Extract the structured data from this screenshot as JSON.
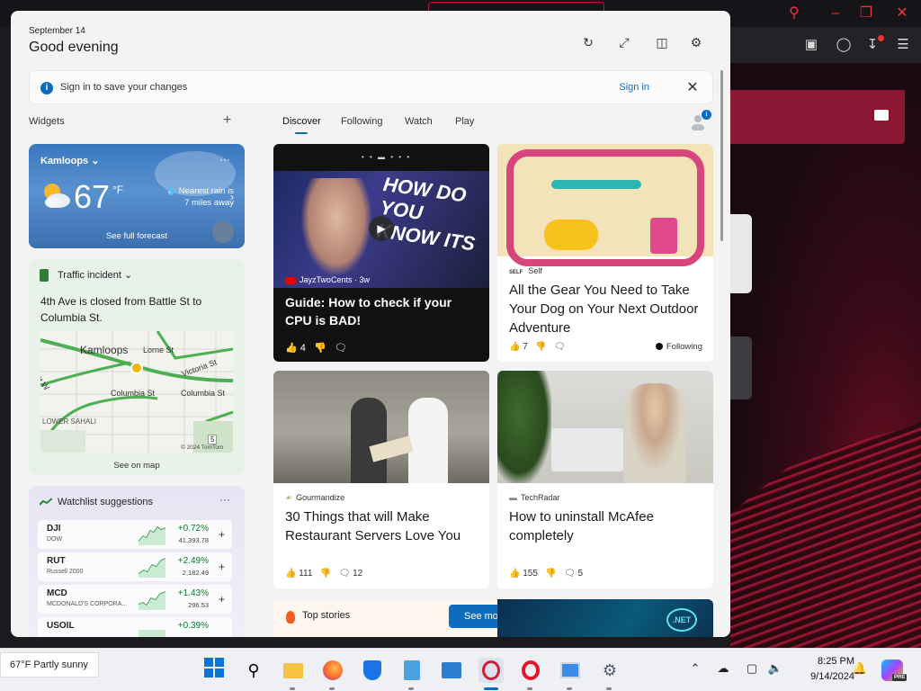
{
  "header": {
    "date": "September 14",
    "greeting": "Good evening"
  },
  "signin": {
    "message": "Sign in to save your changes",
    "link": "Sign in",
    "close": "✕"
  },
  "widgets": {
    "label": "Widgets",
    "add": "+"
  },
  "weather": {
    "city": "Kamloops",
    "temp": "67",
    "unit": "°F",
    "rain": "Nearest rain is 7 miles away",
    "forecast_link": "See full forecast",
    "more": "···"
  },
  "traffic": {
    "title": "Traffic incident",
    "description": "4th Ave is closed from Battle St to Columbia St.",
    "see_on_map": "See on map",
    "map_labels": {
      "city": "Kamloops",
      "lorne": "Lorne St",
      "victoria": "Victoria St",
      "columbia_left": "Columbia St",
      "columbia_right": "Columbia St",
      "street_w": "St W",
      "sahali": "LOWER SAHALI",
      "route": "5",
      "copyright": "© 2024 TomTom"
    }
  },
  "watchlist": {
    "title": "Watchlist suggestions",
    "more": "···",
    "items": [
      {
        "symbol": "DJI",
        "name": "DOW",
        "change": "+0.72%",
        "price": "41,393.78"
      },
      {
        "symbol": "RUT",
        "name": "Russell 2000",
        "change": "+2.49%",
        "price": "2,182.49"
      },
      {
        "symbol": "MCD",
        "name": "MCDONALD'S CORPORA...",
        "change": "+1.43%",
        "price": "296.53"
      },
      {
        "symbol": "USOIL",
        "name": "",
        "change": "+0.39%",
        "price": ""
      }
    ]
  },
  "tabs": [
    "Discover",
    "Following",
    "Watch",
    "Play"
  ],
  "profile_badge": "i",
  "cards": {
    "video": {
      "source": "JayzTwoCents · 3w",
      "title": "Guide: How to check if your CPU is BAD!",
      "likes": "4",
      "thumb_text": "HOW DO YOU KNOW ITS"
    },
    "dog": {
      "source_logo": "SELF",
      "source": "Self",
      "title": "All the Gear You Need to Take Your Dog on Your Next Outdoor Adventure",
      "likes": "7",
      "following": "Following"
    },
    "servers": {
      "source": "Gourmandize",
      "title": "30 Things that will Make Restaurant Servers Love You",
      "likes": "111",
      "comments": "12"
    },
    "mcafee": {
      "source": "TechRadar",
      "title": "How to uninstall McAfee completely",
      "likes": "155",
      "comments": "5"
    },
    "top_stories": {
      "title": "Top stories",
      "button": "See more",
      "net_label": ".NET"
    }
  },
  "taskbar": {
    "weather": "67°F Partly sunny",
    "time": "8:25 PM",
    "date": "9/14/2024",
    "pre_badge": "PRE"
  },
  "colors": {
    "accent": "#0f6cbd",
    "positive": "#0b7a2a",
    "browser_red": "#c01535"
  }
}
